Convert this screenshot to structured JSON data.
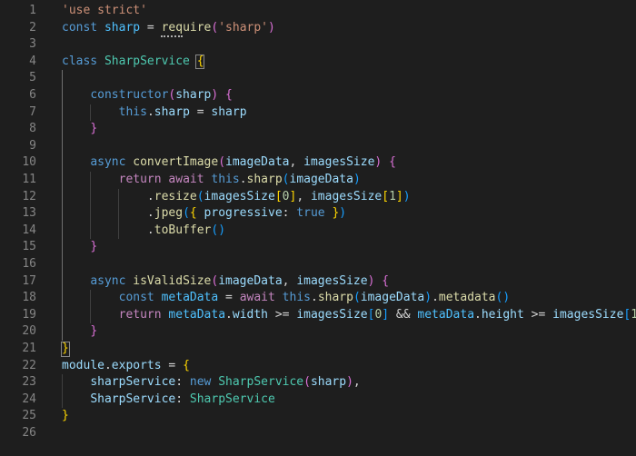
{
  "editor": {
    "language": "javascript",
    "theme": {
      "background": "#1e1e1e",
      "line_number": "#858585",
      "keyword": "#569cd6",
      "control": "#c586c0",
      "string": "#ce9178",
      "function": "#dcdcaa",
      "class": "#4ec9b0",
      "variable": "#9cdcfe",
      "constant": "#4fc1ff",
      "number": "#b5cea8",
      "bracket_level1": "#ffd700",
      "bracket_level2": "#da70d6",
      "bracket_level3": "#179fff"
    },
    "lines": [
      {
        "n": "1",
        "t": [
          [
            "str",
            "'use strict'"
          ]
        ]
      },
      {
        "n": "2",
        "t": [
          [
            "kw",
            "const "
          ],
          [
            "const",
            "sharp"
          ],
          [
            "p",
            " = "
          ],
          [
            "fn",
            "require"
          ],
          [
            "b2",
            "("
          ],
          [
            "str",
            "'sharp'"
          ],
          [
            "b2",
            ")"
          ]
        ]
      },
      {
        "n": "3",
        "t": []
      },
      {
        "n": "4",
        "t": [
          [
            "kw",
            "class "
          ],
          [
            "cls",
            "SharpService"
          ],
          [
            "p",
            " "
          ],
          [
            "b1",
            "{"
          ]
        ]
      },
      {
        "n": "5",
        "t": []
      },
      {
        "n": "6",
        "t": [
          [
            "p",
            "    "
          ],
          [
            "kw",
            "constructor"
          ],
          [
            "b2",
            "("
          ],
          [
            "var",
            "sharp"
          ],
          [
            "b2",
            ")"
          ],
          [
            "p",
            " "
          ],
          [
            "b2",
            "{"
          ]
        ]
      },
      {
        "n": "7",
        "t": [
          [
            "p",
            "        "
          ],
          [
            "kw",
            "this"
          ],
          [
            "p",
            "."
          ],
          [
            "var",
            "sharp"
          ],
          [
            "p",
            " = "
          ],
          [
            "var",
            "sharp"
          ]
        ]
      },
      {
        "n": "8",
        "t": [
          [
            "p",
            "    "
          ],
          [
            "b2",
            "}"
          ]
        ]
      },
      {
        "n": "9",
        "t": []
      },
      {
        "n": "10",
        "t": [
          [
            "p",
            "    "
          ],
          [
            "kw",
            "async "
          ],
          [
            "fn",
            "convertImage"
          ],
          [
            "b2",
            "("
          ],
          [
            "var",
            "imageData"
          ],
          [
            "p",
            ", "
          ],
          [
            "var",
            "imagesSize"
          ],
          [
            "b2",
            ")"
          ],
          [
            "p",
            " "
          ],
          [
            "b2",
            "{"
          ]
        ]
      },
      {
        "n": "11",
        "t": [
          [
            "p",
            "        "
          ],
          [
            "ctl",
            "return "
          ],
          [
            "ctl",
            "await "
          ],
          [
            "kw",
            "this"
          ],
          [
            "p",
            "."
          ],
          [
            "fn",
            "sharp"
          ],
          [
            "b3",
            "("
          ],
          [
            "var",
            "imageData"
          ],
          [
            "b3",
            ")"
          ]
        ]
      },
      {
        "n": "12",
        "t": [
          [
            "p",
            "            ."
          ],
          [
            "fn",
            "resize"
          ],
          [
            "b3",
            "("
          ],
          [
            "var",
            "imagesSize"
          ],
          [
            "b1",
            "["
          ],
          [
            "num",
            "0"
          ],
          [
            "b1",
            "]"
          ],
          [
            "p",
            ", "
          ],
          [
            "var",
            "imagesSize"
          ],
          [
            "b1",
            "["
          ],
          [
            "num",
            "1"
          ],
          [
            "b1",
            "]"
          ],
          [
            "b3",
            ")"
          ]
        ]
      },
      {
        "n": "13",
        "t": [
          [
            "p",
            "            ."
          ],
          [
            "fn",
            "jpeg"
          ],
          [
            "b3",
            "("
          ],
          [
            "b1",
            "{"
          ],
          [
            "p",
            " "
          ],
          [
            "var",
            "progressive"
          ],
          [
            "p",
            ": "
          ],
          [
            "kw",
            "true"
          ],
          [
            "p",
            " "
          ],
          [
            "b1",
            "}"
          ],
          [
            "b3",
            ")"
          ]
        ]
      },
      {
        "n": "14",
        "t": [
          [
            "p",
            "            ."
          ],
          [
            "fn",
            "toBuffer"
          ],
          [
            "b3",
            "()"
          ]
        ]
      },
      {
        "n": "15",
        "t": [
          [
            "p",
            "    "
          ],
          [
            "b2",
            "}"
          ]
        ]
      },
      {
        "n": "16",
        "t": []
      },
      {
        "n": "17",
        "t": [
          [
            "p",
            "    "
          ],
          [
            "kw",
            "async "
          ],
          [
            "fn",
            "isValidSize"
          ],
          [
            "b2",
            "("
          ],
          [
            "var",
            "imageData"
          ],
          [
            "p",
            ", "
          ],
          [
            "var",
            "imagesSize"
          ],
          [
            "b2",
            ")"
          ],
          [
            "p",
            " "
          ],
          [
            "b2",
            "{"
          ]
        ]
      },
      {
        "n": "18",
        "t": [
          [
            "p",
            "        "
          ],
          [
            "kw",
            "const "
          ],
          [
            "const",
            "metaData"
          ],
          [
            "p",
            " = "
          ],
          [
            "ctl",
            "await "
          ],
          [
            "kw",
            "this"
          ],
          [
            "p",
            "."
          ],
          [
            "fn",
            "sharp"
          ],
          [
            "b3",
            "("
          ],
          [
            "var",
            "imageData"
          ],
          [
            "b3",
            ")"
          ],
          [
            "p",
            "."
          ],
          [
            "fn",
            "metadata"
          ],
          [
            "b3",
            "()"
          ]
        ]
      },
      {
        "n": "19",
        "t": [
          [
            "p",
            "        "
          ],
          [
            "ctl",
            "return "
          ],
          [
            "const",
            "metaData"
          ],
          [
            "p",
            "."
          ],
          [
            "var",
            "width"
          ],
          [
            "p",
            " >= "
          ],
          [
            "var",
            "imagesSize"
          ],
          [
            "b3",
            "["
          ],
          [
            "num",
            "0"
          ],
          [
            "b3",
            "]"
          ],
          [
            "p",
            " && "
          ],
          [
            "const",
            "metaData"
          ],
          [
            "p",
            "."
          ],
          [
            "var",
            "height"
          ],
          [
            "p",
            " >= "
          ],
          [
            "var",
            "imagesSize"
          ],
          [
            "b3",
            "["
          ],
          [
            "num",
            "1"
          ],
          [
            "b3",
            "]"
          ]
        ]
      },
      {
        "n": "20",
        "t": [
          [
            "p",
            "    "
          ],
          [
            "b2",
            "}"
          ]
        ]
      },
      {
        "n": "21",
        "t": [
          [
            "b1",
            "}"
          ]
        ]
      },
      {
        "n": "22",
        "t": [
          [
            "var",
            "module"
          ],
          [
            "p",
            "."
          ],
          [
            "var",
            "exports"
          ],
          [
            "p",
            " = "
          ],
          [
            "b1",
            "{"
          ]
        ]
      },
      {
        "n": "23",
        "t": [
          [
            "p",
            "    "
          ],
          [
            "var",
            "sharpService"
          ],
          [
            "p",
            ": "
          ],
          [
            "kw",
            "new "
          ],
          [
            "cls",
            "SharpService"
          ],
          [
            "b2",
            "("
          ],
          [
            "var",
            "sharp"
          ],
          [
            "b2",
            ")"
          ],
          [
            "p",
            ","
          ]
        ]
      },
      {
        "n": "24",
        "t": [
          [
            "p",
            "    "
          ],
          [
            "var",
            "SharpService"
          ],
          [
            "p",
            ": "
          ],
          [
            "cls",
            "SharpService"
          ]
        ]
      },
      {
        "n": "25",
        "t": [
          [
            "b1",
            "}"
          ]
        ]
      },
      {
        "n": "26",
        "t": []
      }
    ]
  }
}
